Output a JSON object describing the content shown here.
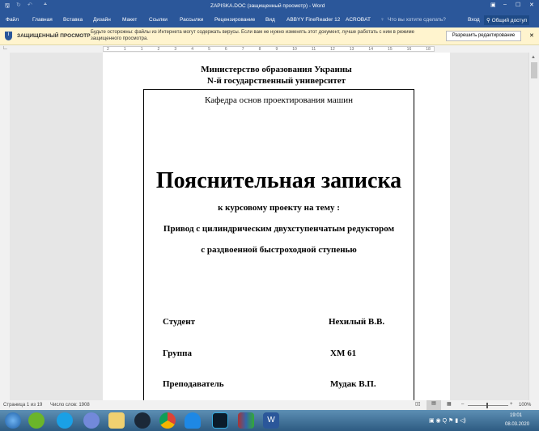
{
  "window": {
    "title": "ZAPISKA.DOC (защищенный просмотр) - Word"
  },
  "ribbon": {
    "tabs": [
      "Файл",
      "Главная",
      "Вставка",
      "Дизайн",
      "Макет",
      "Ссылки",
      "Рассылки",
      "Рецензирование",
      "Вид",
      "ABBYY FineReader 12",
      "ACROBAT"
    ],
    "tell_me": "Что вы хотите сделать?",
    "sign_in": "Вход",
    "share": "Общий доступ"
  },
  "message_bar": {
    "title": "ЗАЩИЩЕННЫЙ ПРОСМОТР",
    "text": "Будьте осторожны: файлы из Интернета могут содержать вирусы. Если вам не нужно изменять этот документ, лучше работать с ним в режиме защищенного просмотра.",
    "button": "Разрешить редактирование"
  },
  "ruler": {
    "ticks": [
      "2",
      "1",
      "1",
      "2",
      "3",
      "4",
      "5",
      "6",
      "7",
      "8",
      "9",
      "10",
      "11",
      "12",
      "13",
      "14",
      "15",
      "16",
      "18"
    ]
  },
  "document": {
    "ministry": "Министерство образования Украины",
    "university": "N-й государственный университет",
    "department": "Кафедра основ проектирования машин",
    "title": "Пояснительная записка",
    "subtitle": "к курсовому проекту на тему :",
    "topic1": "Привод с цилиндрическим двухступенчатым редуктором",
    "topic2": "с раздвоенной быстроходной ступенью",
    "student_label": "Студент",
    "student_value": "Нехилый  В.В.",
    "group_label": "Группа",
    "group_value": "ХМ  61",
    "teacher_label": "Преподаватель",
    "teacher_value": "Мудак  В.П."
  },
  "status": {
    "page": "Страница 1 из 19",
    "words": "Число слов: 1908",
    "zoom": "100%"
  },
  "taskbar": {
    "time": "19:01",
    "date": "08.03.2020"
  }
}
